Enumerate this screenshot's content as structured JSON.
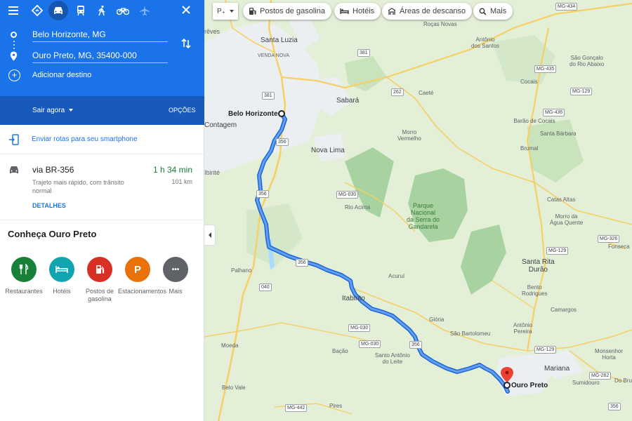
{
  "directions": {
    "origin": "Belo Horizonte, MG",
    "destination": "Ouro Preto, MG, 35400-000",
    "add_destination": "Adicionar destino",
    "depart": "Sair agora",
    "options": "OPÇÕES",
    "send_to_phone": "Enviar rotas para seu smartphone",
    "route": {
      "via": "via BR-356",
      "time": "1 h 34 min",
      "description": "Trajeto mais rápido, com trânsito normal",
      "distance": "101 km",
      "details": "DETALHES"
    }
  },
  "discover": {
    "title": "Conheça Ouro Preto",
    "categories": [
      {
        "label": "Restaurantes",
        "color": "#188038",
        "icon": "fork-knife-icon"
      },
      {
        "label": "Hotéis",
        "color": "#12a4af",
        "icon": "bed-icon"
      },
      {
        "label": "Postos de gasolina",
        "color": "#d93025",
        "icon": "gas-station-icon"
      },
      {
        "label": "Estacionamentos",
        "color": "#e8710a",
        "icon": "parking-icon",
        "glyph": "P"
      },
      {
        "label": "Mais",
        "color": "#5f6368",
        "icon": "more-icon",
        "glyph": "•••"
      }
    ]
  },
  "map_chips": {
    "layer": "P₊",
    "items": [
      "Postos de gasolina",
      "Hotéis",
      "Áreas de descanso",
      "Mais"
    ]
  },
  "map": {
    "origin_label": "Belo Horizonte",
    "destination_label": "Ouro Preto",
    "places": {
      "reves": "rêves",
      "santa_luzia": "Santa Luzia",
      "venda_nova": "VENDA NOVA",
      "rocas_novas": "Roças Novas",
      "antonio_santos": "Antônio\ndos Santos",
      "sao_goncalo": "São Gonçalo\ndo Rio Abaixo",
      "cocais": "Cocais",
      "caete": "Caeté",
      "sabara": "Sabará",
      "barao_cocais": "Barão de Cocais",
      "contagem": "Contagem",
      "morro_vermelho": "Morro\nVermelho",
      "santa_barbara": "Santa Bárbara",
      "brumal": "Brumal",
      "nova_lima": "Nova Lima",
      "ibirite": "Ibirité",
      "rio_acima": "Rio Acima",
      "parque": "Parque\nNacional\nda Serra do\nGandarela",
      "catas_altas": "Catas Altas",
      "morro_agua_quente": "Morro da\nÁgua Quente",
      "fonseca": "Fonseca",
      "palhano": "Palhano",
      "santa_rita_durao": "Santa Rita\nDurão",
      "acuruí": "Acuruí",
      "bento_rodrigues": "Bento\nRodrigues",
      "itabirito": "Itabirito",
      "camargos": "Camargos",
      "gloria": "Glória",
      "sao_bartolomeu": "São Bartolomeu",
      "antonio_pereira": "Antônio\nPereira",
      "moeda": "Moeda",
      "bacao": "Bação",
      "santo_antonio_leite": "Santo Antônio\ndo Leite",
      "mariana": "Mariana",
      "monsenhor_horta": "Monsenhor\nHorta",
      "sumidouro": "Sumidouro",
      "belo_vale": "Belo Vale",
      "pires": "Pires",
      "do_bru": "Do Bru"
    },
    "shields": [
      "MG-434",
      "381",
      "MG-435",
      "381",
      "262",
      "MG-129",
      "MG-436",
      "356",
      "MG-030",
      "356",
      "MG-326",
      "MG-129",
      "040",
      "356",
      "MG-030",
      "MG-030",
      "MG-129",
      "356",
      "MG-262",
      "MG-442",
      "356"
    ]
  }
}
